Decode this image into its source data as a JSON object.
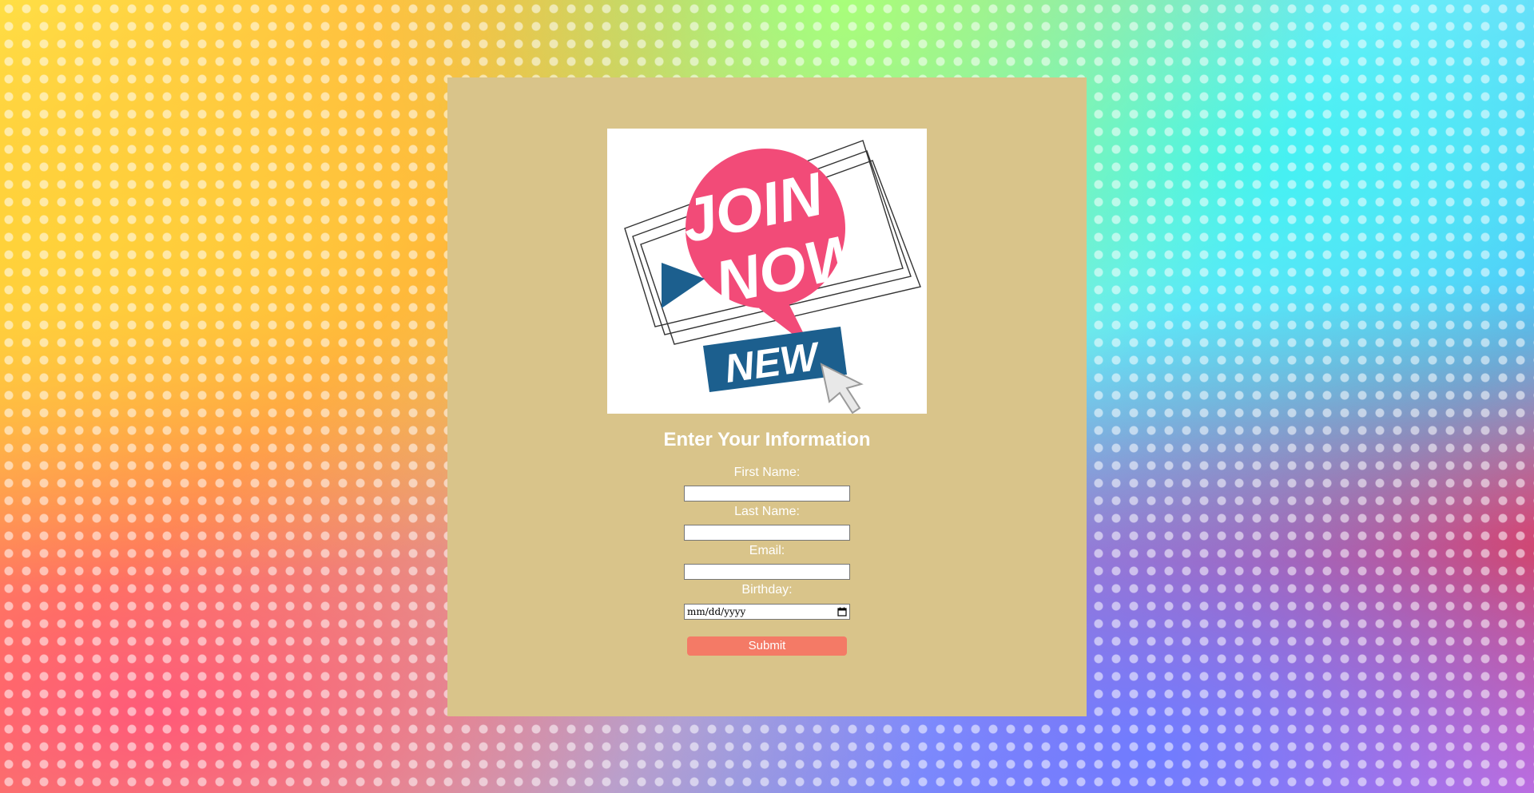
{
  "hero_image": {
    "icon": "join-now-badge",
    "headline_line1": "JOIN",
    "headline_line2": "NOW!",
    "ribbon_text": "NEW",
    "colors": {
      "bubble": "#f24b78",
      "ribbon": "#1c5f8e",
      "frame": "#333333"
    }
  },
  "form": {
    "title": "Enter Your Information",
    "first_name_label": "First Name:",
    "first_name_value": "",
    "last_name_label": "Last Name:",
    "last_name_value": "",
    "email_label": "Email:",
    "email_value": "",
    "birthday_label": "Birthday:",
    "birthday_placeholder": "mm/dd/yyyy",
    "submit_label": "Submit"
  },
  "colors": {
    "card_background": "#d9c48a",
    "submit_background": "#f47a66",
    "label_text": "#ffffff"
  }
}
